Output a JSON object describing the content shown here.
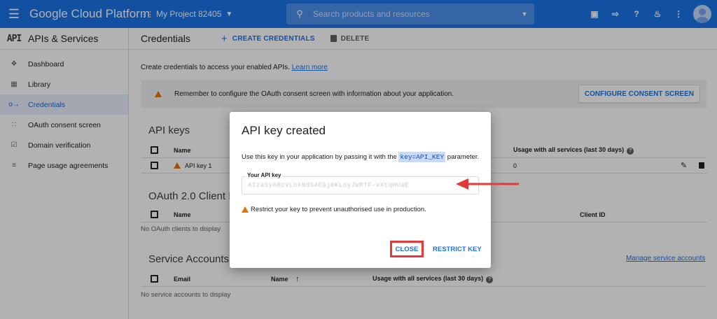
{
  "topbar": {
    "app_title": "Google Cloud Platform",
    "project": "My Project 82405",
    "search_placeholder": "Search products and resources"
  },
  "sidebar": {
    "logo": "API",
    "title": "APIs & Services",
    "items": [
      {
        "label": "Dashboard",
        "icon": "dashboard-icon"
      },
      {
        "label": "Library",
        "icon": "library-icon"
      },
      {
        "label": "Credentials",
        "icon": "key-icon",
        "active": true
      },
      {
        "label": "OAuth consent screen",
        "icon": "consent-icon"
      },
      {
        "label": "Domain verification",
        "icon": "domain-icon"
      },
      {
        "label": "Page usage agreements",
        "icon": "settings-list-icon"
      }
    ]
  },
  "main": {
    "title": "Credentials",
    "create_label": "CREATE CREDENTIALS",
    "delete_label": "DELETE",
    "intro_text": "Create credentials to access your enabled APIs.",
    "intro_link": "Learn more",
    "banner_text": "Remember to configure the OAuth consent screen with information about your application.",
    "configure_label": "CONFIGURE CONSENT SCREEN",
    "api_keys": {
      "title": "API keys",
      "col_name": "Name",
      "col_usage": "Usage with all services (last 30 days)",
      "rows": [
        {
          "name": "API key 1",
          "usage": "0"
        }
      ]
    },
    "oauth": {
      "title": "OAuth 2.0 Client IDs",
      "col_name": "Name",
      "col_client": "Client ID",
      "empty": "No OAuth clients to display"
    },
    "service_accounts": {
      "title": "Service Accounts",
      "manage_link": "Manage service accounts",
      "col_email": "Email",
      "col_name": "Name",
      "col_usage": "Usage with all services (last 30 days)",
      "empty": "No service accounts to display"
    }
  },
  "dialog": {
    "title": "API key created",
    "desc_before": "Use this key in your application by passing it with the",
    "desc_code": "key=API_KEY",
    "desc_after": "parameter.",
    "key_label": "Your API key",
    "key_value": "AIzaSyA8cVLnXNdS4EGj0KLoyJWRTF-vXtqHUaE",
    "restrict_note": "Restrict your key to prevent unauthorised use in production.",
    "close_label": "CLOSE",
    "restrict_label": "RESTRICT KEY"
  },
  "colors": {
    "brand_blue": "#1a73e8",
    "highlight_red": "#e53935",
    "warning_orange": "#e37400"
  }
}
